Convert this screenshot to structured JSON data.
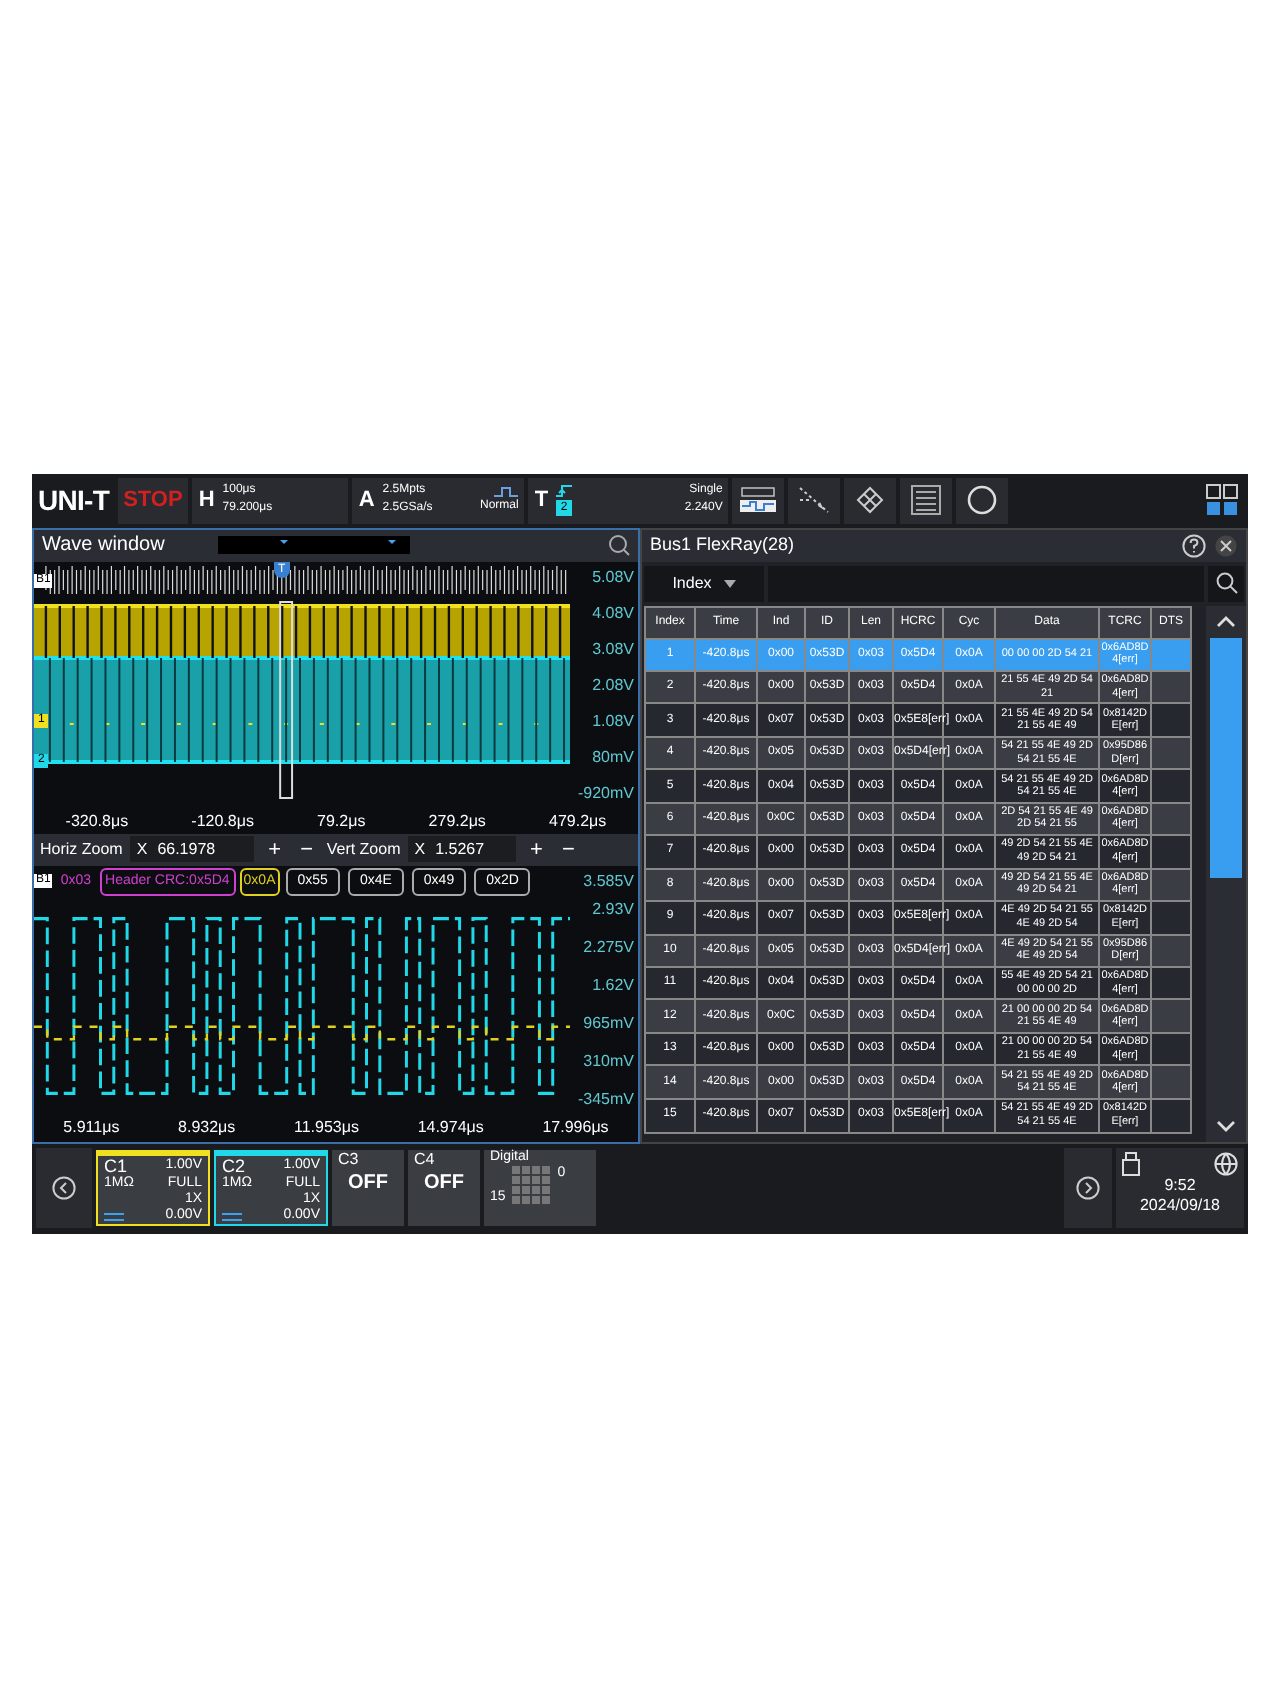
{
  "top_bar": {
    "logo": "UNI-T",
    "run_state": "STOP",
    "horizontal": {
      "label": "H",
      "scale": "100μs",
      "offset": "79.200μs"
    },
    "acquire": {
      "label": "A",
      "depth": "2.5Mpts",
      "rate": "2.5GSa/s",
      "mode": "Normal"
    },
    "trigger": {
      "label": "T",
      "source": "2",
      "type": "Single",
      "level": "2.240V"
    }
  },
  "wave_window": {
    "title": "Wave window",
    "trigger_marker": "T",
    "bus_marker": "B1",
    "channel_markers": [
      "1",
      "2"
    ],
    "volt_labels": [
      "5.08V",
      "4.08V",
      "3.08V",
      "2.08V",
      "1.08V",
      "80mV",
      "-920mV"
    ],
    "time_labels": [
      "-320.8μs",
      "-120.8μs",
      "79.2μs",
      "279.2μs",
      "479.2μs"
    ],
    "zoom": {
      "horiz_label": "Horiz Zoom",
      "horiz_x": "X",
      "horiz_value": "66.1978",
      "vert_label": "Vert Zoom",
      "vert_x": "X",
      "vert_value": "1.5267",
      "plus": "+",
      "minus": "−"
    },
    "decode_marker": "B1",
    "decode": [
      {
        "kind": "plain",
        "text": "0x03"
      },
      {
        "kind": "header",
        "text": "Header CRC:0x5D4"
      },
      {
        "kind": "cycle",
        "text": "0x0A"
      },
      {
        "kind": "data",
        "text": "0x55"
      },
      {
        "kind": "data",
        "text": "0x4E"
      },
      {
        "kind": "data",
        "text": "0x49"
      },
      {
        "kind": "data",
        "text": "0x2D"
      }
    ],
    "zoom_volt_labels": [
      "3.585V",
      "2.93V",
      "2.275V",
      "1.62V",
      "965mV",
      "310mV",
      "-345mV"
    ],
    "zoom_time_labels": [
      "5.911μs",
      "8.932μs",
      "11.953μs",
      "14.974μs",
      "17.996μs"
    ]
  },
  "bus_panel": {
    "title": "Bus1 FlexRay(28)",
    "filter": "Index",
    "columns": [
      "Index",
      "Time",
      "Ind",
      "ID",
      "Len",
      "HCRC",
      "Cyc",
      "Data",
      "TCRC",
      "DTS"
    ],
    "rows": [
      {
        "selected": true,
        "cells": [
          "1",
          "-420.8μs",
          "0x00",
          "0x53D",
          "0x03",
          "0x5D4",
          "0x0A",
          "00 00 00 2D 54 21",
          "0x6AD8D4[err]",
          ""
        ]
      },
      {
        "selected": false,
        "cells": [
          "2",
          "-420.8μs",
          "0x00",
          "0x53D",
          "0x03",
          "0x5D4",
          "0x0A",
          "21 55 4E 49 2D 54 21",
          "0x6AD8D4[err]",
          ""
        ]
      },
      {
        "selected": false,
        "cells": [
          "3",
          "-420.8μs",
          "0x07",
          "0x53D",
          "0x03",
          "0x5E8[err]",
          "0x0A",
          "21 55 4E 49 2D 54 21 55 4E 49",
          "0x8142DE[err]",
          ""
        ]
      },
      {
        "selected": false,
        "cells": [
          "4",
          "-420.8μs",
          "0x05",
          "0x53D",
          "0x03",
          "0x5D4[err]",
          "0x0A",
          "54 21 55 4E 49 2D 54 21 55 4E",
          "0x95D86D[err]",
          ""
        ]
      },
      {
        "selected": false,
        "cells": [
          "5",
          "-420.8μs",
          "0x04",
          "0x53D",
          "0x03",
          "0x5D4",
          "0x0A",
          "54 21 55 4E 49 2D 54 21 55 4E",
          "0x6AD8D4[err]",
          ""
        ]
      },
      {
        "selected": false,
        "cells": [
          "6",
          "-420.8μs",
          "0x0C",
          "0x53D",
          "0x03",
          "0x5D4",
          "0x0A",
          "2D 54 21 55 4E 49 2D 54 21 55",
          "0x6AD8D4[err]",
          ""
        ]
      },
      {
        "selected": false,
        "cells": [
          "7",
          "-420.8μs",
          "0x00",
          "0x53D",
          "0x03",
          "0x5D4",
          "0x0A",
          "49 2D 54 21 55 4E 49 2D 54 21",
          "0x6AD8D4[err]",
          ""
        ]
      },
      {
        "selected": false,
        "cells": [
          "8",
          "-420.8μs",
          "0x00",
          "0x53D",
          "0x03",
          "0x5D4",
          "0x0A",
          "49 2D 54 21 55 4E 49 2D 54 21",
          "0x6AD8D4[err]",
          ""
        ]
      },
      {
        "selected": false,
        "cells": [
          "9",
          "-420.8μs",
          "0x07",
          "0x53D",
          "0x03",
          "0x5E8[err]",
          "0x0A",
          "4E 49 2D 54 21 55 4E 49 2D 54",
          "0x8142DE[err]",
          ""
        ]
      },
      {
        "selected": false,
        "cells": [
          "10",
          "-420.8μs",
          "0x05",
          "0x53D",
          "0x03",
          "0x5D4[err]",
          "0x0A",
          "4E 49 2D 54 21 55 4E 49 2D 54",
          "0x95D86D[err]",
          ""
        ]
      },
      {
        "selected": false,
        "cells": [
          "11",
          "-420.8μs",
          "0x04",
          "0x53D",
          "0x03",
          "0x5D4",
          "0x0A",
          "55 4E 49 2D 54 21 00 00 00 2D",
          "0x6AD8D4[err]",
          ""
        ]
      },
      {
        "selected": false,
        "cells": [
          "12",
          "-420.8μs",
          "0x0C",
          "0x53D",
          "0x03",
          "0x5D4",
          "0x0A",
          "21 00 00 00 2D 54 21 55 4E 49",
          "0x6AD8D4[err]",
          ""
        ]
      },
      {
        "selected": false,
        "cells": [
          "13",
          "-420.8μs",
          "0x00",
          "0x53D",
          "0x03",
          "0x5D4",
          "0x0A",
          "21 00 00 00 2D 54 21 55 4E 49",
          "0x6AD8D4[err]",
          ""
        ]
      },
      {
        "selected": false,
        "cells": [
          "14",
          "-420.8μs",
          "0x00",
          "0x53D",
          "0x03",
          "0x5D4",
          "0x0A",
          "54 21 55 4E 49 2D 54 21 55 4E",
          "0x6AD8D4[err]",
          ""
        ]
      },
      {
        "selected": false,
        "cells": [
          "15",
          "-420.8μs",
          "0x07",
          "0x53D",
          "0x03",
          "0x5E8[err]",
          "0x0A",
          "54 21 55 4E 49 2D 54 21 55 4E",
          "0x8142DE[err]",
          ""
        ]
      }
    ]
  },
  "channels": [
    {
      "kind": "on",
      "name": "C1",
      "color": "#f0e020",
      "scale": "1.00V",
      "impedance": "1MΩ",
      "bandwidth": "FULL",
      "probe": "1X",
      "offset": "0.00V"
    },
    {
      "kind": "on",
      "name": "C2",
      "color": "#20d8e8",
      "scale": "1.00V",
      "impedance": "1MΩ",
      "bandwidth": "FULL",
      "probe": "1X",
      "offset": "0.00V"
    },
    {
      "kind": "off",
      "name": "C3",
      "state": "OFF"
    },
    {
      "kind": "off",
      "name": "C4",
      "state": "OFF"
    },
    {
      "kind": "digital",
      "name": "Digital",
      "high": "0",
      "low": "15"
    }
  ],
  "status": {
    "time": "9:52",
    "date": "2024/09/18"
  }
}
